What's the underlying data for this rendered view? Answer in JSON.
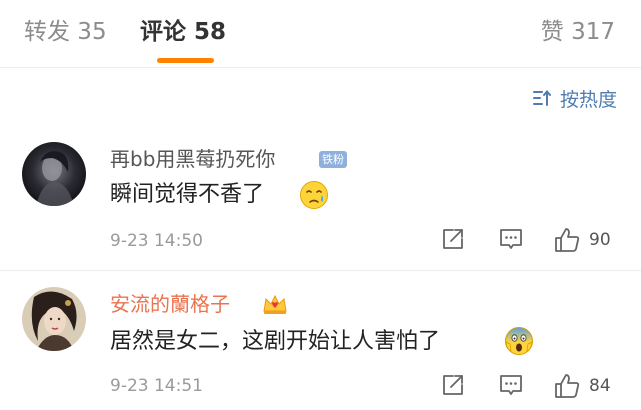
{
  "tabs": {
    "repost": "转发 35",
    "comment": "评论 58",
    "like": "赞 317"
  },
  "sort": {
    "label": "按热度"
  },
  "comments": [
    {
      "username": "再bb用黑莓扔死你",
      "badge": "铁粉",
      "text": "瞬间觉得不香了",
      "emoji": "sad-tear-emoji",
      "time": "9-23 14:50",
      "likes": "90"
    },
    {
      "username": "安流的蘭格子",
      "badge_icon": "crown-icon",
      "text": "居然是女二，这剧开始让人害怕了",
      "emoji": "scream-emoji",
      "time": "9-23 14:51",
      "likes": "84"
    }
  ],
  "colors": {
    "accent": "#ff8200",
    "link": "#507daf",
    "vip_name": "#eb7350",
    "badge": "#8fb0dc"
  }
}
